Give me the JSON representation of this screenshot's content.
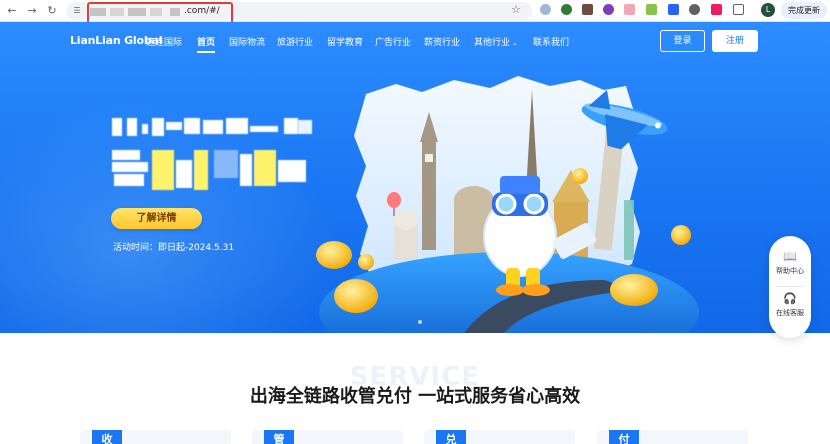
{
  "browser": {
    "url_visible": ".com/#/",
    "update_button": "完成更新",
    "profile_initial": "L",
    "icons": [
      "back-icon",
      "forward-icon",
      "reload-icon",
      "site-info-icon",
      "bookmark-star-icon",
      "extensions-icon",
      "menu-icon"
    ]
  },
  "header": {
    "logo": "LianLian Global",
    "logo_cn": "连连国际",
    "nav": [
      {
        "label": "首页",
        "active": true
      },
      {
        "label": "国际物流"
      },
      {
        "label": "旅游行业"
      },
      {
        "label": "留学教育"
      },
      {
        "label": "广告行业"
      },
      {
        "label": "薪资行业"
      },
      {
        "label": "其他行业"
      },
      {
        "label": "联系我们"
      }
    ],
    "login_label": "登录",
    "register_label": "注册"
  },
  "hero": {
    "detail_button": "了解详情",
    "activity_time": "活动时间：即日起-2024.5.31"
  },
  "float_panel": {
    "help_label": "帮助中心",
    "service_label": "在线客服"
  },
  "section": {
    "background_word": "SERVICE",
    "title": "出海全链路收管兑付 一站式服务省心高效",
    "cards": [
      {
        "tag": "收"
      },
      {
        "tag": "管"
      },
      {
        "tag": "兑"
      },
      {
        "tag": "付"
      }
    ]
  },
  "colors": {
    "brand_blue": "#1a76f2",
    "accent_yellow": "#ffc72a",
    "highlight_red": "#e53935"
  }
}
